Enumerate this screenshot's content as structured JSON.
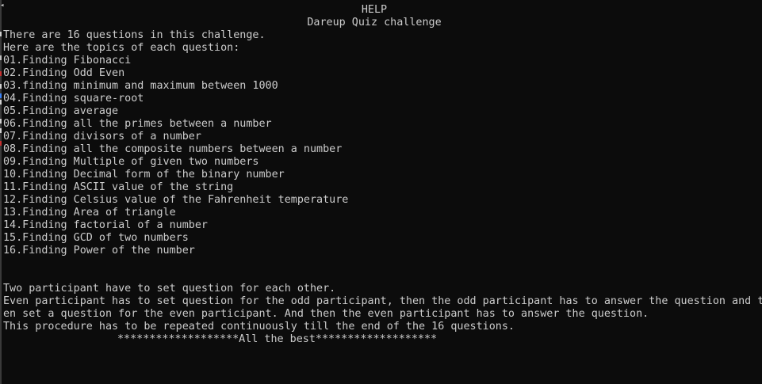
{
  "console": {
    "title": "HELP",
    "subtitle": "Dareup Quiz challenge",
    "intro_count": "There are 16 questions in this challenge.",
    "intro_topics": "Here are the topics of each question:",
    "topics": [
      "01.Finding Fibonacci",
      "02.Finding Odd Even",
      "03.finding minimum and maximum between 1000",
      "04.Finding square-root",
      "05.Finding average",
      "06.Finding all the primes between a number",
      "07.Finding divisors of a number",
      "08.Finding all the composite numbers between a number",
      "09.Finding Multiple of given two numbers",
      "10.Finding Decimal form of the binary number",
      "11.Finding ASCII value of the string",
      "12.Finding Celsius value of the Fahrenheit temperature",
      "13.Finding Area of triangle",
      "14.Finding factorial of a number",
      "15.Finding GCD of two numbers",
      "16.Finding Power of the number"
    ],
    "rules": [
      "Two participant have to set question for each other.",
      "Even participant has to set question for the odd participant, then the odd participant has to answer the question and th",
      "en set a question for the even participant. And then the even participant has to answer the question.",
      "This procedure has to be repeated continuously till the end of the 16 questions."
    ],
    "closing": "*******************All the best*******************",
    "colors": {
      "background": "#0c0c0c",
      "text": "#cccccc"
    }
  }
}
